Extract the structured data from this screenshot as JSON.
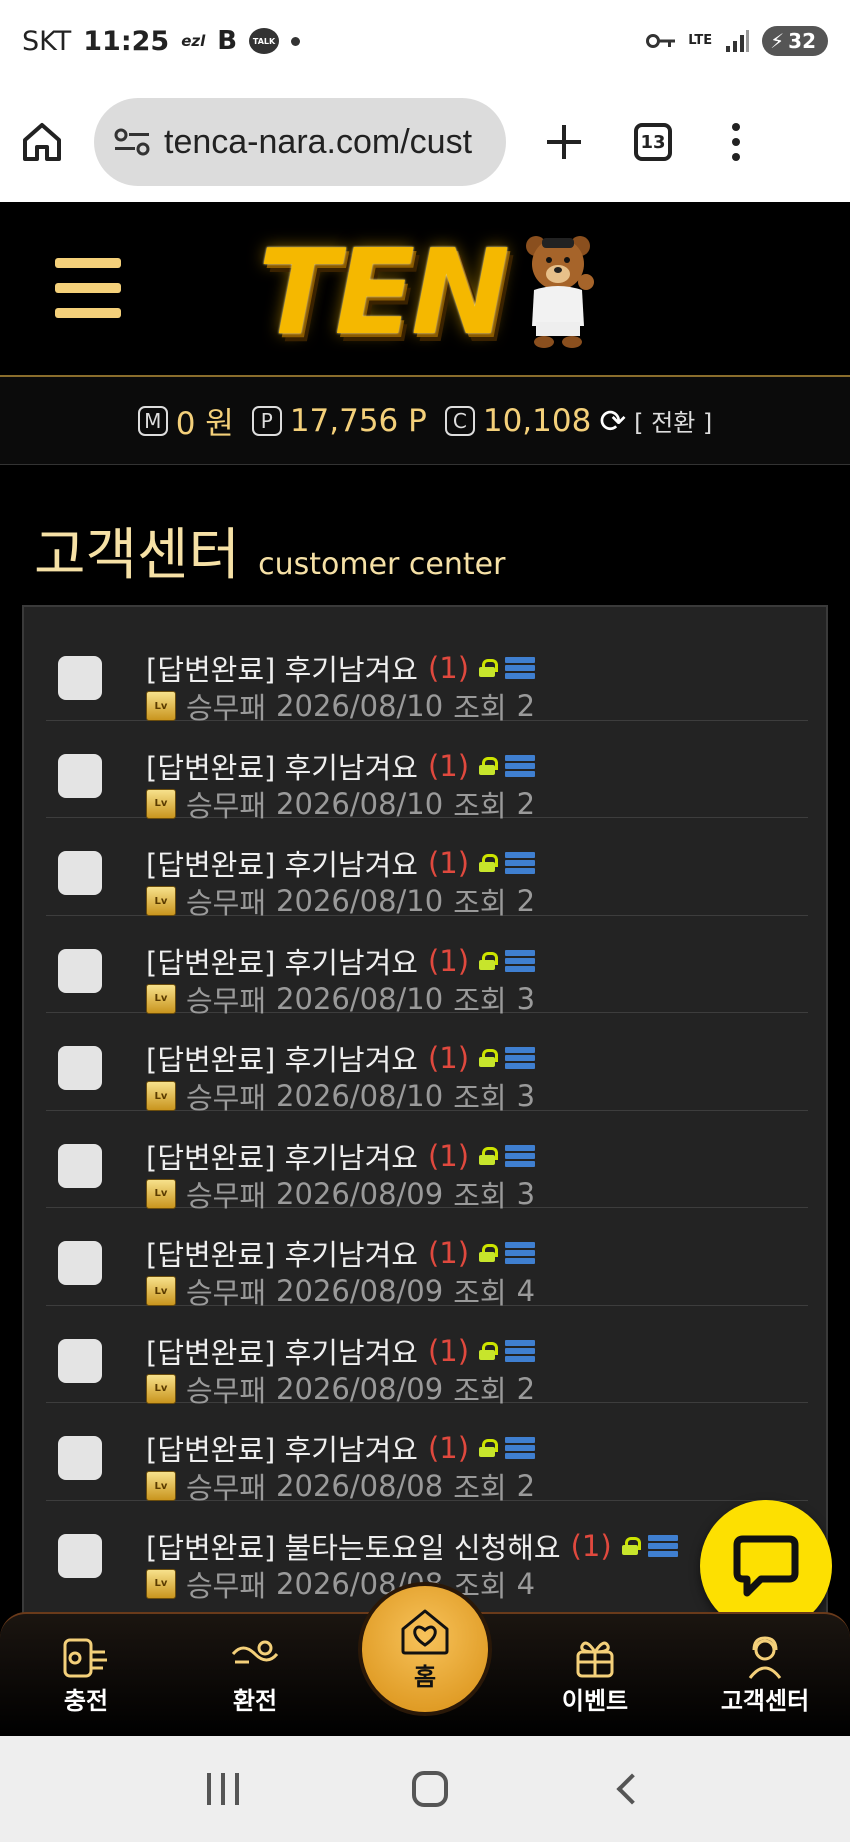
{
  "status_bar": {
    "carrier": "SKT",
    "time": "11:25",
    "battery": "32",
    "network": "LTE"
  },
  "browser": {
    "url": "tenca-nara.com/cust",
    "tab_count": "13"
  },
  "header": {
    "logo_text": "TEN"
  },
  "points": {
    "money_value": "0 원",
    "point_value": "17,756 P",
    "coin_value": "10,108",
    "convert_label": "[ 전환 ]"
  },
  "page": {
    "title_ko": "고객센터",
    "title_en": "customer center"
  },
  "posts": [
    {
      "title": "[답변완료] 후기남겨요",
      "comments": "(1)",
      "author": "승무패",
      "date": "2026/08/10",
      "views_label": "조회",
      "views": "2"
    },
    {
      "title": "[답변완료] 후기남겨요",
      "comments": "(1)",
      "author": "승무패",
      "date": "2026/08/10",
      "views_label": "조회",
      "views": "2"
    },
    {
      "title": "[답변완료] 후기남겨요",
      "comments": "(1)",
      "author": "승무패",
      "date": "2026/08/10",
      "views_label": "조회",
      "views": "2"
    },
    {
      "title": "[답변완료] 후기남겨요",
      "comments": "(1)",
      "author": "승무패",
      "date": "2026/08/10",
      "views_label": "조회",
      "views": "3"
    },
    {
      "title": "[답변완료] 후기남겨요",
      "comments": "(1)",
      "author": "승무패",
      "date": "2026/08/10",
      "views_label": "조회",
      "views": "3"
    },
    {
      "title": "[답변완료] 후기남겨요",
      "comments": "(1)",
      "author": "승무패",
      "date": "2026/08/09",
      "views_label": "조회",
      "views": "3"
    },
    {
      "title": "[답변완료] 후기남겨요",
      "comments": "(1)",
      "author": "승무패",
      "date": "2026/08/09",
      "views_label": "조회",
      "views": "4"
    },
    {
      "title": "[답변완료] 후기남겨요",
      "comments": "(1)",
      "author": "승무패",
      "date": "2026/08/09",
      "views_label": "조회",
      "views": "2"
    },
    {
      "title": "[답변완료] 후기남겨요",
      "comments": "(1)",
      "author": "승무패",
      "date": "2026/08/08",
      "views_label": "조회",
      "views": "2"
    },
    {
      "title": "[답변완료] 불타는토요일 신청해요",
      "comments": "(1)",
      "author": "승무패",
      "date": "2026/08/08",
      "views_label": "조회",
      "views": "4"
    }
  ],
  "bottom_nav": {
    "charge": "충전",
    "exchange": "환전",
    "home": "홈",
    "event": "이벤트",
    "support": "고객센터"
  },
  "colors": {
    "gold": "#f4d07a",
    "comment_red": "#e0493e",
    "chat_yellow": "#fde001"
  }
}
